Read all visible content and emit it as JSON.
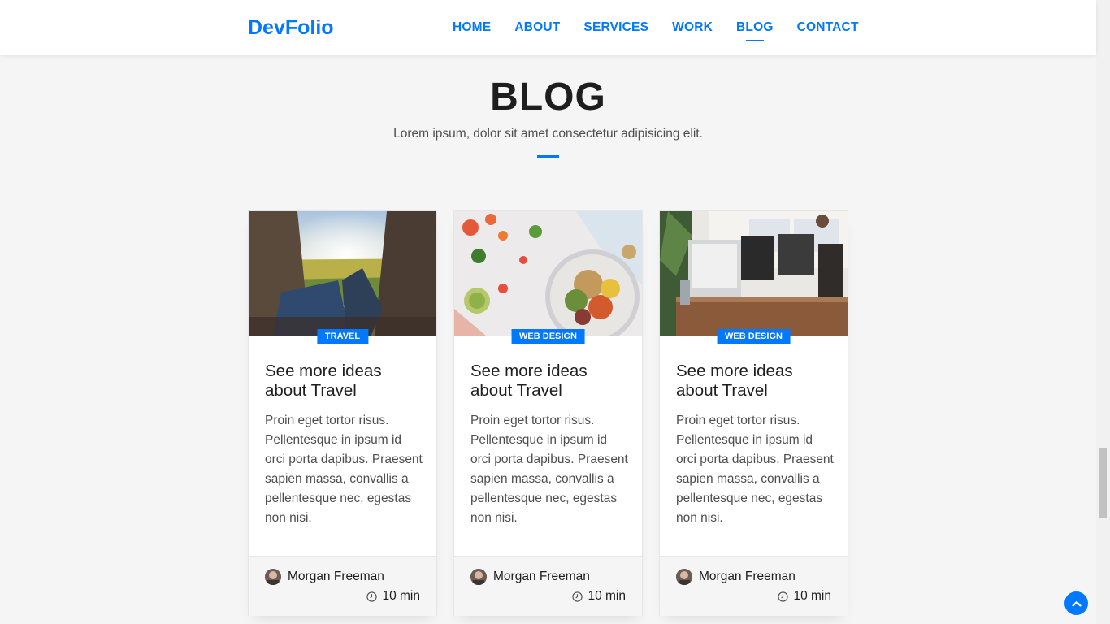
{
  "brand": "DevFolio",
  "nav": {
    "items": [
      {
        "label": "HOME"
      },
      {
        "label": "ABOUT"
      },
      {
        "label": "SERVICES"
      },
      {
        "label": "WORK"
      },
      {
        "label": "BLOG"
      },
      {
        "label": "CONTACT"
      }
    ],
    "active": "BLOG"
  },
  "section": {
    "title": "BLOG",
    "subtitle": "Lorem ipsum, dolor sit amet consectetur adipisicing elit."
  },
  "cards": [
    {
      "category": "TRAVEL",
      "title": "See more ideas about Travel",
      "text": "Proin eget tortor risus. Pellentesque in ipsum id orci porta dapibus. Praesent sapien massa, convallis a pellentesque nec, egestas non nisi.",
      "author": "Morgan Freeman",
      "read_time": "10 min",
      "image": "travel-photo"
    },
    {
      "category": "WEB DESIGN",
      "title": "See more ideas about Travel",
      "text": "Proin eget tortor risus. Pellentesque in ipsum id orci porta dapibus. Praesent sapien massa, convallis a pellentesque nec, egestas non nisi.",
      "author": "Morgan Freeman",
      "read_time": "10 min",
      "image": "food-photo"
    },
    {
      "category": "WEB DESIGN",
      "title": "See more ideas about Travel",
      "text": "Proin eget tortor risus. Pellentesque in ipsum id orci porta dapibus. Praesent sapien massa, convallis a pellentesque nec, egestas non nisi.",
      "author": "Morgan Freeman",
      "read_time": "10 min",
      "image": "office-photo"
    }
  ],
  "icons": {
    "clock": "clock-icon",
    "back_to_top": "chevron-up-icon"
  },
  "colors": {
    "accent": "#0078ff",
    "heading": "#1e1e1e",
    "body_text": "#4e4e4e",
    "background": "#f5f5f5"
  }
}
